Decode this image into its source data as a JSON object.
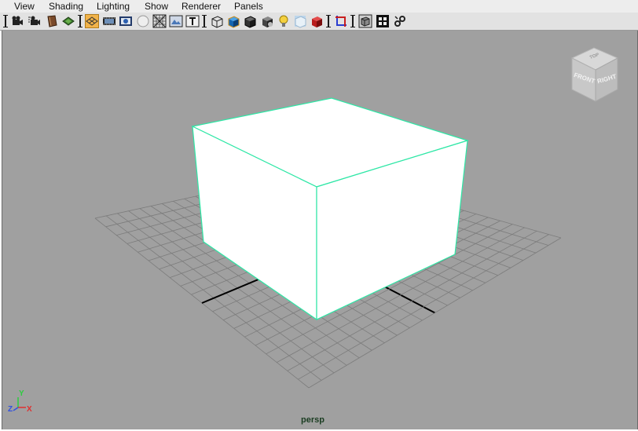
{
  "menu": {
    "view": "View",
    "shading": "Shading",
    "lighting": "Lighting",
    "show": "Show",
    "renderer": "Renderer",
    "panels": "Panels"
  },
  "toolbar": {
    "icons": [
      "select-camera-icon",
      "camera-attributes-icon",
      "bookmarks-icon",
      "image-plane-icon",
      "grid-toggle-icon",
      "film-gate-icon",
      "resolution-gate-icon",
      "gate-mask-icon",
      "field-chart-icon",
      "safe-action-icon",
      "safe-title-icon",
      "wireframe-icon",
      "smooth-shade-icon",
      "shade-wireframe-icon",
      "use-default-material-icon",
      "use-all-lights-icon",
      "shadows-icon",
      "hardware-texturing-icon",
      "isolate-select-icon",
      "xray-icon",
      "xray-joints-icon",
      "xray-active-components-icon"
    ],
    "active_icon": "grid-toggle-icon"
  },
  "viewport": {
    "camera_label": "persp",
    "viewcube": {
      "front": "FRONT",
      "right": "RIGHT",
      "top": "TOP"
    },
    "axis": {
      "x": "X",
      "y": "Y",
      "z": "Z"
    },
    "colors": {
      "background": "#a0a0a0",
      "grid": "#7c7c7c",
      "grid_axis": "#000000",
      "selection": "#2ee7a6",
      "object": "#ffffff"
    }
  }
}
